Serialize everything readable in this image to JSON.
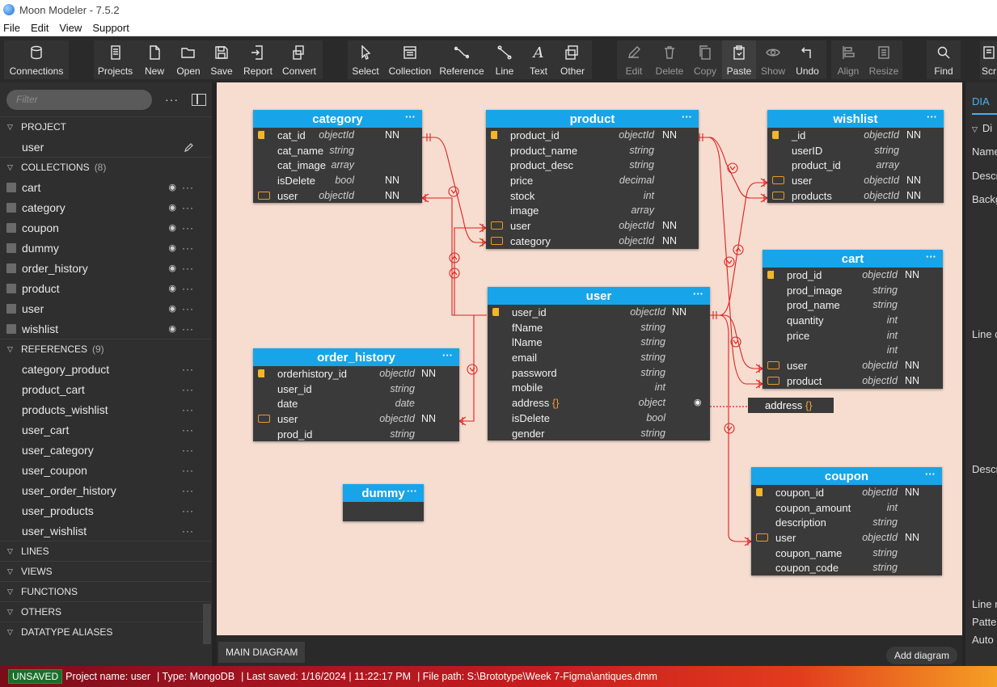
{
  "window": {
    "title": "Moon Modeler - 7.5.2"
  },
  "menu": [
    "File",
    "Edit",
    "View",
    "Support"
  ],
  "toolbar": {
    "connections": "Connections",
    "projects": "Projects",
    "new": "New",
    "open": "Open",
    "save": "Save",
    "report": "Report",
    "convert": "Convert",
    "select": "Select",
    "collection": "Collection",
    "reference": "Reference",
    "line": "Line",
    "text": "Text",
    "other": "Other",
    "edit": "Edit",
    "delete": "Delete",
    "copy": "Copy",
    "paste": "Paste",
    "show": "Show",
    "undo": "Undo",
    "align": "Align",
    "resize": "Resize",
    "find": "Find",
    "scr": "Scr"
  },
  "sidebar": {
    "filter_placeholder": "Filter",
    "project": {
      "label": "PROJECT",
      "item": "user"
    },
    "collections": {
      "label": "COLLECTIONS",
      "count": "(8)",
      "items": [
        "cart",
        "category",
        "coupon",
        "dummy",
        "order_history",
        "product",
        "user",
        "wishlist"
      ]
    },
    "references": {
      "label": "REFERENCES",
      "count": "(9)",
      "items": [
        "category_product",
        "product_cart",
        "products_wishlist",
        "user_cart",
        "user_category",
        "user_coupon",
        "user_order_history",
        "user_products",
        "user_wishlist"
      ]
    },
    "lines": "LINES",
    "views": "VIEWS",
    "functions": "FUNCTIONS",
    "others": "OTHERS",
    "datatype_aliases": "DATATYPE ALIASES"
  },
  "entities": {
    "category": {
      "title": "category",
      "fields": [
        {
          "name": "cat_id",
          "type": "objectId",
          "nn": "NN",
          "icon": "key"
        },
        {
          "name": "cat_name",
          "type": "string",
          "nn": "",
          "icon": ""
        },
        {
          "name": "cat_image",
          "type": "array",
          "nn": "",
          "icon": ""
        },
        {
          "name": "isDelete",
          "type": "bool",
          "nn": "NN",
          "icon": ""
        },
        {
          "name": "user",
          "type": "objectId",
          "nn": "NN",
          "icon": "ref"
        }
      ]
    },
    "product": {
      "title": "product",
      "fields": [
        {
          "name": "product_id",
          "type": "objectId",
          "nn": "NN",
          "icon": "key"
        },
        {
          "name": "product_name",
          "type": "string",
          "nn": "",
          "icon": ""
        },
        {
          "name": "product_desc",
          "type": "string",
          "nn": "",
          "icon": ""
        },
        {
          "name": "price",
          "type": "decimal",
          "nn": "",
          "icon": ""
        },
        {
          "name": "stock",
          "type": "int",
          "nn": "",
          "icon": ""
        },
        {
          "name": "image",
          "type": "array",
          "nn": "",
          "icon": ""
        },
        {
          "name": "user",
          "type": "objectId",
          "nn": "NN",
          "icon": "ref"
        },
        {
          "name": "category",
          "type": "objectId",
          "nn": "NN",
          "icon": "ref"
        }
      ]
    },
    "wishlist": {
      "title": "wishlist",
      "fields": [
        {
          "name": "_id",
          "type": "objectId",
          "nn": "NN",
          "icon": "key"
        },
        {
          "name": "userID",
          "type": "string",
          "nn": "",
          "icon": ""
        },
        {
          "name": "product_id",
          "type": "array",
          "nn": "",
          "icon": ""
        },
        {
          "name": "user",
          "type": "objectId",
          "nn": "NN",
          "icon": "ref"
        },
        {
          "name": "products",
          "type": "objectId",
          "nn": "NN",
          "icon": "ref"
        }
      ]
    },
    "cart": {
      "title": "cart",
      "fields": [
        {
          "name": "prod_id",
          "type": "objectId",
          "nn": "NN",
          "icon": "key"
        },
        {
          "name": "prod_image",
          "type": "string",
          "nn": "",
          "icon": ""
        },
        {
          "name": "prod_name",
          "type": "string",
          "nn": "",
          "icon": ""
        },
        {
          "name": "quantity",
          "type": "int",
          "nn": "",
          "icon": ""
        },
        {
          "name": "price",
          "type": "int",
          "nn": "",
          "icon": ""
        },
        {
          "name": "",
          "type": "int",
          "nn": "",
          "icon": ""
        },
        {
          "name": "user",
          "type": "objectId",
          "nn": "NN",
          "icon": "ref"
        },
        {
          "name": "product",
          "type": "objectId",
          "nn": "NN",
          "icon": "ref"
        }
      ]
    },
    "user": {
      "title": "user",
      "fields": [
        {
          "name": "user_id",
          "type": "objectId",
          "nn": "NN",
          "icon": "key"
        },
        {
          "name": "fName",
          "type": "string",
          "nn": "",
          "icon": ""
        },
        {
          "name": "lName",
          "type": "string",
          "nn": "",
          "icon": ""
        },
        {
          "name": "email",
          "type": "string",
          "nn": "",
          "icon": ""
        },
        {
          "name": "password",
          "type": "string",
          "nn": "",
          "icon": ""
        },
        {
          "name": "mobile",
          "type": "int",
          "nn": "",
          "icon": ""
        },
        {
          "name": "address",
          "braces": "{}",
          "type": "object",
          "nn": "",
          "icon": "",
          "eye": true
        },
        {
          "name": "isDelete",
          "type": "bool",
          "nn": "",
          "icon": ""
        },
        {
          "name": "gender",
          "type": "string",
          "nn": "",
          "icon": ""
        }
      ]
    },
    "order_history": {
      "title": "order_history",
      "fields": [
        {
          "name": "orderhistory_id",
          "type": "objectId",
          "nn": "NN",
          "icon": "key"
        },
        {
          "name": "user_id",
          "type": "string",
          "nn": "",
          "icon": ""
        },
        {
          "name": "date",
          "type": "date",
          "nn": "",
          "icon": ""
        },
        {
          "name": "user",
          "type": "objectId",
          "nn": "NN",
          "icon": "ref"
        },
        {
          "name": "prod_id",
          "type": "string",
          "nn": "",
          "icon": ""
        }
      ]
    },
    "coupon": {
      "title": "coupon",
      "fields": [
        {
          "name": "coupon_id",
          "type": "objectId",
          "nn": "NN",
          "icon": "key"
        },
        {
          "name": "coupon_amount",
          "type": "int",
          "nn": "",
          "icon": ""
        },
        {
          "name": "description",
          "type": "string",
          "nn": "",
          "icon": ""
        },
        {
          "name": "user",
          "type": "objectId",
          "nn": "NN",
          "icon": "ref"
        },
        {
          "name": "coupon_name",
          "type": "string",
          "nn": "",
          "icon": ""
        },
        {
          "name": "coupon_code",
          "type": "string",
          "nn": "",
          "icon": ""
        }
      ]
    },
    "dummy": {
      "title": "dummy",
      "fields": []
    }
  },
  "address_note": {
    "name": "address",
    "braces": "{}"
  },
  "entity_menu": "···",
  "tabs": {
    "main": "MAIN DIAGRAM",
    "add": "Add diagram"
  },
  "right_panel": {
    "tab": "DIA",
    "section": "Di",
    "name": "Name",
    "desc": "Descr",
    "background": "Backg",
    "line": "Line c",
    "description": "Descr",
    "line2": "Line r",
    "pattern": "Patte",
    "auto": "Auto"
  },
  "status": {
    "badge": "UNSAVED",
    "project": "Project name: user",
    "type": "| Type: MongoDB",
    "saved": "| Last saved: 1/16/2024 | 11:22:17 PM",
    "path": "| File path: S:\\Brototype\\Week 7-Figma\\antiques.dmm"
  },
  "colors": {
    "entity_header": "#18a4e8",
    "canvas": "#f6ddd0",
    "relation_line": "#e02020",
    "key_icon": "#f2b628",
    "ref_icon": "#e59b2a"
  }
}
